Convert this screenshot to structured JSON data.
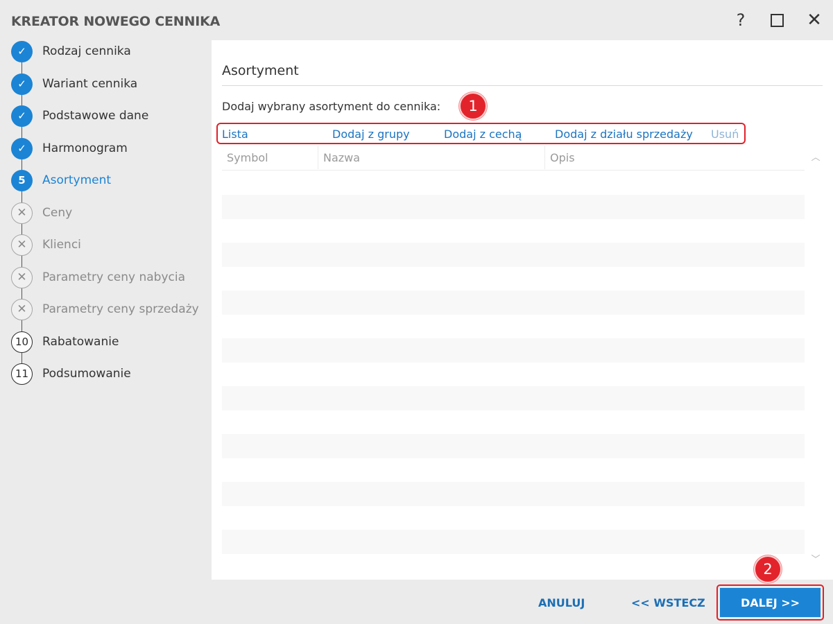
{
  "window": {
    "title": "KREATOR NOWEGO CENNIKA",
    "help_label": "?",
    "close_label": "✕"
  },
  "steps": [
    {
      "marker": "✓",
      "label": "Rodzaj cennika",
      "state": "done"
    },
    {
      "marker": "✓",
      "label": "Wariant cennika",
      "state": "done"
    },
    {
      "marker": "✓",
      "label": "Podstawowe dane",
      "state": "done"
    },
    {
      "marker": "✓",
      "label": "Harmonogram",
      "state": "done"
    },
    {
      "marker": "5",
      "label": "Asortyment",
      "state": "current"
    },
    {
      "marker": "✕",
      "label": "Ceny",
      "state": "disabled"
    },
    {
      "marker": "✕",
      "label": "Klienci",
      "state": "disabled"
    },
    {
      "marker": "✕",
      "label": "Parametry ceny nabycia",
      "state": "disabled"
    },
    {
      "marker": "✕",
      "label": "Parametry ceny sprzedaży",
      "state": "disabled"
    },
    {
      "marker": "10",
      "label": "Rabatowanie",
      "state": "pending"
    },
    {
      "marker": "11",
      "label": "Podsumowanie",
      "state": "pending"
    }
  ],
  "main": {
    "section_title": "Asortyment",
    "instruction": "Dodaj wybrany asortyment do cennika:",
    "actions": {
      "lista": "Lista",
      "grupy": "Dodaj z grupy",
      "cecha": "Dodaj z cechą",
      "dzial": "Dodaj z działu sprzedaży",
      "usun": "Usuń"
    },
    "grid": {
      "columns": [
        "Symbol",
        "Nazwa",
        "Opis"
      ],
      "rows": []
    },
    "scroll_up_icon": "chevron-up-icon",
    "scroll_down_icon": "chevron-down-icon"
  },
  "callouts": {
    "first": "1",
    "second": "2"
  },
  "footer": {
    "cancel_label": "ANULUJ",
    "back_label": "<< WSTECZ",
    "next_label": "DALEJ >>"
  },
  "colors": {
    "accent": "#1b84d5",
    "callout": "#e3232b"
  }
}
